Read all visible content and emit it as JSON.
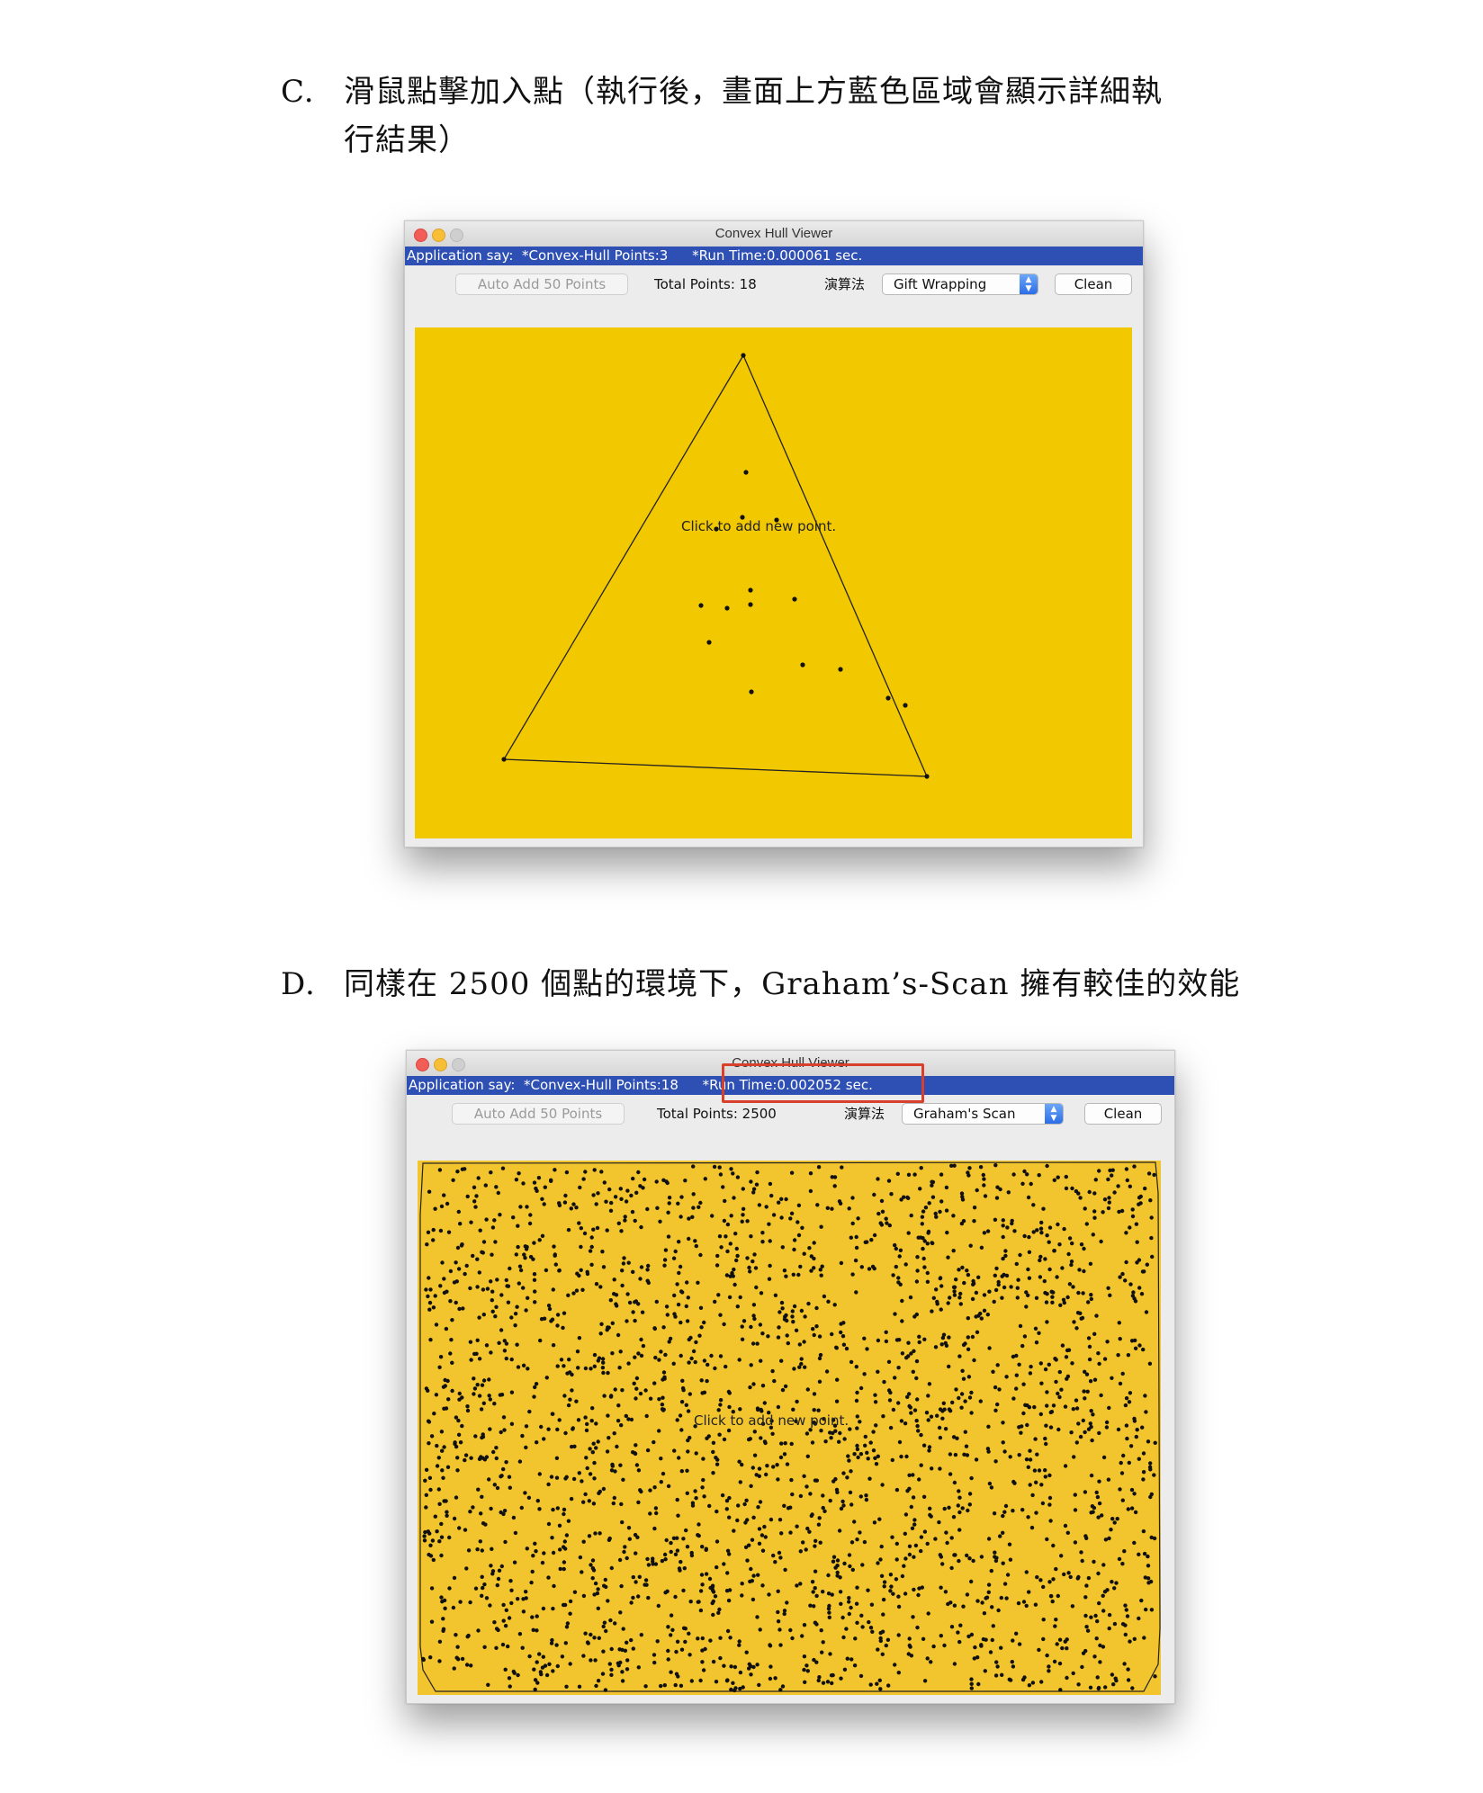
{
  "sections": [
    {
      "letter": "C.",
      "line1": "滑鼠點擊加入點（執行後，畫面上方藍色區域會顯示詳細執",
      "line2": "行結果）",
      "window": {
        "title": "Convex Hull Viewer",
        "status": {
          "prefix": "Application say:",
          "hull": "*Convex-Hull Points:3",
          "runtime": "*Run Time:0.000061 sec."
        },
        "toolbar": {
          "auto_add": "Auto Add 50 Points",
          "total": "Total Points: 18",
          "algo_label": "演算法",
          "algo_value": "Gift Wrapping",
          "clean": "Clean"
        },
        "canvas_color": "#f2c800",
        "hint": "Click to add new point."
      }
    },
    {
      "letter": "D.",
      "line1": "同樣在 2500 個點的環境下，Graham’s-Scan 擁有較佳的效能",
      "window": {
        "title": "Convex Hull Viewer",
        "status": {
          "prefix": "Application say:",
          "hull": "*Convex-Hull Points:18",
          "runtime": "*Run Time:0.002052 sec."
        },
        "toolbar": {
          "auto_add": "Auto Add 50 Points",
          "total": "Total Points: 2500",
          "algo_label": "演算法",
          "algo_value": "Graham's Scan",
          "clean": "Clean"
        },
        "canvas_color": "#f2c42e",
        "hint": "Click to add new point."
      }
    }
  ],
  "colors": {
    "status_bar": "#2e4fb3",
    "highlight_box": "#d9402b",
    "point": "#111111"
  },
  "icons": [
    "close-light-icon",
    "minimize-light-icon",
    "maximize-light-icon",
    "select-arrows-icon"
  ]
}
